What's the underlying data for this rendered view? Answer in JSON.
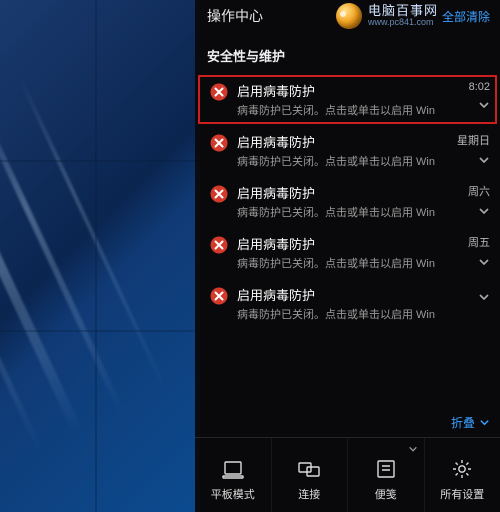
{
  "panel": {
    "title": "操作中心",
    "clear_all": "全部清除",
    "section_title": "安全性与维护",
    "collapse_label": "折叠"
  },
  "watermark": {
    "cn": "电脑百事网",
    "en": "www.pc841.com"
  },
  "notifications": [
    {
      "title": "启用病毒防护",
      "desc": "病毒防护已关闭。点击或单击以启用 Win",
      "time": "8:02",
      "highlighted": true
    },
    {
      "title": "启用病毒防护",
      "desc": "病毒防护已关闭。点击或单击以启用 Win",
      "time": "星期日"
    },
    {
      "title": "启用病毒防护",
      "desc": "病毒防护已关闭。点击或单击以启用 Win",
      "time": "周六"
    },
    {
      "title": "启用病毒防护",
      "desc": "病毒防护已关闭。点击或单击以启用 Win",
      "time": "周五"
    },
    {
      "title": "启用病毒防护",
      "desc": "病毒防护已关闭。点击或单击以启用 Win",
      "time": ""
    }
  ],
  "quick_actions": [
    {
      "label": "平板模式",
      "icon": "tablet"
    },
    {
      "label": "连接",
      "icon": "connect"
    },
    {
      "label": "便笺",
      "icon": "note",
      "has_chevron": true
    },
    {
      "label": "所有设置",
      "icon": "settings"
    }
  ],
  "colors": {
    "accent": "#3aa0ff",
    "error": "#d33a2c",
    "highlight_border": "#cc2020"
  }
}
